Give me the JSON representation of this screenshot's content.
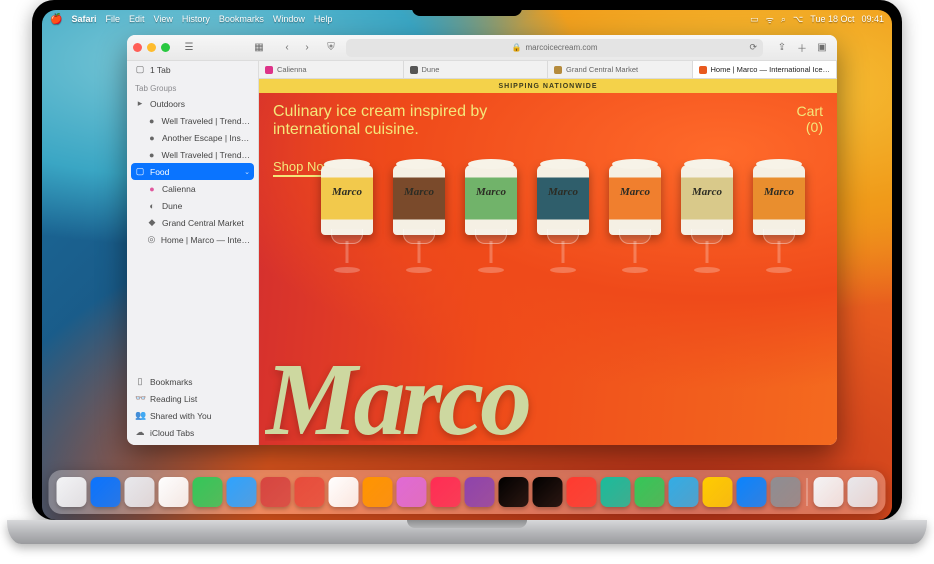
{
  "menubar": {
    "appmenu": "Safari",
    "items": [
      "File",
      "Edit",
      "View",
      "History",
      "Bookmarks",
      "Window",
      "Help"
    ],
    "status_date": "Tue 18 Oct",
    "status_time": "09:41"
  },
  "safari": {
    "address": "marcoicecream.com",
    "tabs": [
      {
        "label": "Calienna"
      },
      {
        "label": "Dune"
      },
      {
        "label": "Grand Central Market"
      },
      {
        "label": "Home | Marco — International Ice…"
      }
    ],
    "active_tab_index": 3,
    "sidebar": {
      "one_tab": "1 Tab",
      "groups_label": "Tab Groups",
      "groups": [
        {
          "name": "Outdoors",
          "items": [
            "Well Traveled | Trend…",
            "Another Escape | Ins…",
            "Well Traveled | Trend…"
          ]
        },
        {
          "name": "Food",
          "selected": true,
          "items": [
            "Calienna",
            "Dune",
            "Grand Central Market",
            "Home | Marco — Inte…"
          ]
        }
      ],
      "bottom": [
        "Bookmarks",
        "Reading List",
        "Shared with You",
        "iCloud Tabs"
      ]
    }
  },
  "page": {
    "banner": "SHIPPING NATIONWIDE",
    "headline": "Culinary ice cream inspired by international cuisine.",
    "cta": "Shop Now",
    "cart_label": "Cart",
    "cart_count": "(0)",
    "brand": "Marco",
    "pint_colors": [
      "#f2c94c",
      "#7a4a2b",
      "#71b36a",
      "#2f5e6b",
      "#f07f2e",
      "#d9c98a",
      "#e98e2e"
    ]
  },
  "dock": {
    "apps": [
      "#f4f4f6",
      "#0a74ff",
      "#e9e9ed",
      "#ffffff",
      "#34c759",
      "#2ea3ff",
      "#d64541",
      "#e74c3c",
      "#ffffff",
      "#ff9500",
      "#e06ad6",
      "#ff2d55",
      "#8e44ad",
      "#000000",
      "#000000",
      "#ff3b30",
      "#1abc9c",
      "#34c759",
      "#32ade6",
      "#ffcc00",
      "#0a84ff",
      "#8e8e93"
    ],
    "after_sep": [
      "#f4f4f6",
      "#e9e9ed"
    ]
  }
}
